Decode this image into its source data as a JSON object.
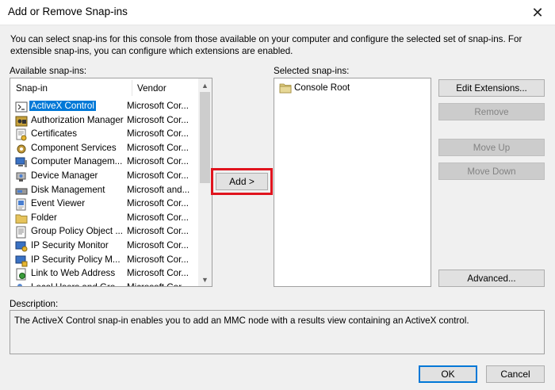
{
  "window": {
    "title": "Add or Remove Snap-ins",
    "close_glyph": "✕"
  },
  "intro": {
    "line1": "You can select snap-ins for this console from those available on your computer and configure the selected set of snap-ins. For",
    "line2": "extensible snap-ins, you can configure which extensions are enabled."
  },
  "available": {
    "label": "Available snap-ins:",
    "columns": [
      "Snap-in",
      "Vendor"
    ],
    "rows": [
      {
        "name": "ActiveX Control",
        "vendor": "Microsoft Cor...",
        "icon": "activex-icon",
        "selected": true
      },
      {
        "name": "Authorization Manager",
        "vendor": "Microsoft Cor...",
        "icon": "authorization-manager-icon"
      },
      {
        "name": "Certificates",
        "vendor": "Microsoft Cor...",
        "icon": "certificates-icon"
      },
      {
        "name": "Component Services",
        "vendor": "Microsoft Cor...",
        "icon": "component-services-icon"
      },
      {
        "name": "Computer Managem...",
        "vendor": "Microsoft Cor...",
        "icon": "computer-management-icon"
      },
      {
        "name": "Device Manager",
        "vendor": "Microsoft Cor...",
        "icon": "device-manager-icon"
      },
      {
        "name": "Disk Management",
        "vendor": "Microsoft and...",
        "icon": "disk-management-icon"
      },
      {
        "name": "Event Viewer",
        "vendor": "Microsoft Cor...",
        "icon": "event-viewer-icon"
      },
      {
        "name": "Folder",
        "vendor": "Microsoft Cor...",
        "icon": "folder-icon"
      },
      {
        "name": "Group Policy Object ...",
        "vendor": "Microsoft Cor...",
        "icon": "group-policy-icon"
      },
      {
        "name": "IP Security Monitor",
        "vendor": "Microsoft Cor...",
        "icon": "ip-security-monitor-icon"
      },
      {
        "name": "IP Security Policy M...",
        "vendor": "Microsoft Cor...",
        "icon": "ip-security-policy-icon"
      },
      {
        "name": "Link to Web Address",
        "vendor": "Microsoft Cor...",
        "icon": "link-icon"
      },
      {
        "name": "Local Users and Gro...",
        "vendor": "Microsoft Cor...",
        "icon": "local-users-icon"
      }
    ],
    "scroll_up_glyph": "▲",
    "scroll_down_glyph": "▼"
  },
  "add_button": "Add >",
  "selected": {
    "label": "Selected snap-ins:",
    "items": [
      {
        "name": "Console Root",
        "icon": "folder-icon"
      }
    ]
  },
  "buttons": {
    "edit_extensions": "Edit Extensions...",
    "remove": "Remove",
    "move_up": "Move Up",
    "move_down": "Move Down",
    "advanced": "Advanced..."
  },
  "description": {
    "label": "Description:",
    "text": "The ActiveX Control snap-in enables you to add an MMC node with a results view containing an ActiveX control."
  },
  "ok": "OK",
  "cancel": "Cancel",
  "colors": {
    "selection": "#0078d7",
    "highlight_border": "#e0141e",
    "disabled_text": "#838383"
  }
}
